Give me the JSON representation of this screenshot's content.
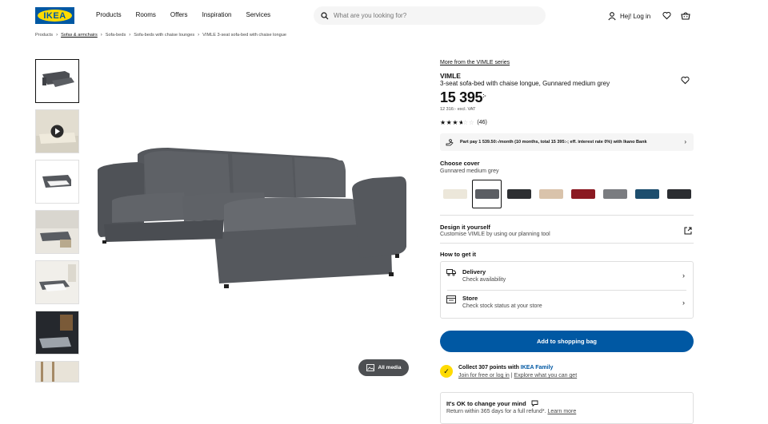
{
  "header": {
    "logo_text": "IKEA",
    "nav": [
      "Products",
      "Rooms",
      "Offers",
      "Inspiration",
      "Services"
    ],
    "search_placeholder": "What are you looking for?",
    "login_label": "Hej! Log in"
  },
  "breadcrumb": [
    "Products",
    "Sofas & armchairs",
    "Sofa-beds",
    "Sofa-beds with chaise lounges",
    "VIMLE 3-seat sofa-bed with chaise longue"
  ],
  "media": {
    "all_media_label": "All media"
  },
  "product": {
    "series_link": "More from the VIMLE series",
    "name": "VIMLE",
    "description": "3-seat sofa-bed with chaise longue, Gunnared medium grey",
    "price_main": "15 395",
    "price_suffix": ":-",
    "price_excl_vat": "12 316:- excl. VAT",
    "rating_count": "(46)",
    "rating_value": 3.5,
    "payment_text": "Part pay 1 539.50:-/month (10 months, total 15 395:-; eff. interest rate 0%) with Ikano Bank"
  },
  "cover": {
    "title": "Choose cover",
    "selected": "Gunnared medium grey",
    "swatch_colors": [
      "#ece7da",
      "#5b5e63",
      "#2d2f32",
      "#d9c3ab",
      "#8b1a22",
      "#7a7c80",
      "#1d4e6e",
      "#2b2d31"
    ]
  },
  "design": {
    "title": "Design it yourself",
    "subtitle": "Customise VIMLE by using our planning tool"
  },
  "howto": {
    "title": "How to get it",
    "delivery_title": "Delivery",
    "delivery_sub": "Check availability",
    "store_title": "Store",
    "store_sub": "Check stock status at your store"
  },
  "actions": {
    "add_to_bag": "Add to shopping bag"
  },
  "family": {
    "text_prefix": "Collect 307 points with ",
    "text_brand": "IKEA Family",
    "join": "Join for free or log in",
    "separator": "|",
    "explore": "Explore what you can get"
  },
  "returns": {
    "title": "It's OK to change your mind",
    "text": "Return within 365 days for a full refund*.",
    "link": "Learn more"
  }
}
